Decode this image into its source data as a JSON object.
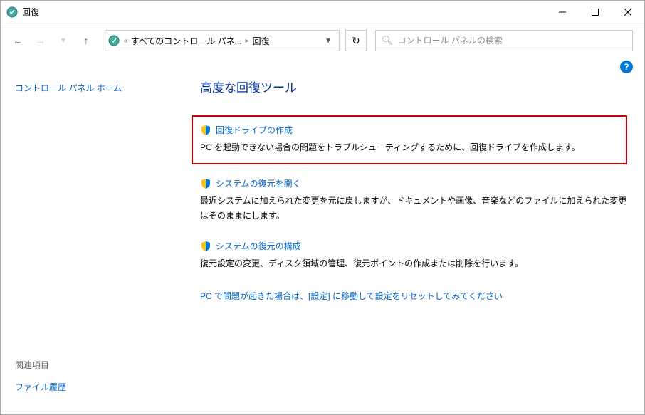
{
  "titlebar": {
    "title": "回復"
  },
  "breadcrumb": {
    "prefix": "«",
    "part1": "すべてのコントロール パネ...",
    "part2": "回復"
  },
  "search": {
    "placeholder": "コントロール パネルの検索"
  },
  "sidebar": {
    "home_link": "コントロール パネル ホーム",
    "related_title": "関連項目",
    "file_history": "ファイル履歴"
  },
  "main": {
    "heading": "高度な回復ツール",
    "options": [
      {
        "title": "回復ドライブの作成",
        "desc": "PC を起動できない場合の問題をトラブルシューティングするために、回復ドライブを作成します。"
      },
      {
        "title": "システムの復元を開く",
        "desc": "最近システムに加えられた変更を元に戻しますが、ドキュメントや画像、音楽などのファイルに加えられた変更はそのままにします。"
      },
      {
        "title": "システムの復元の構成",
        "desc": "復元設定の変更、ディスク領域の管理、復元ポイントの作成または削除を行います。"
      }
    ],
    "settings_link": "PC で問題が起きた場合は、[設定] に移動して設定をリセットしてみてください"
  }
}
